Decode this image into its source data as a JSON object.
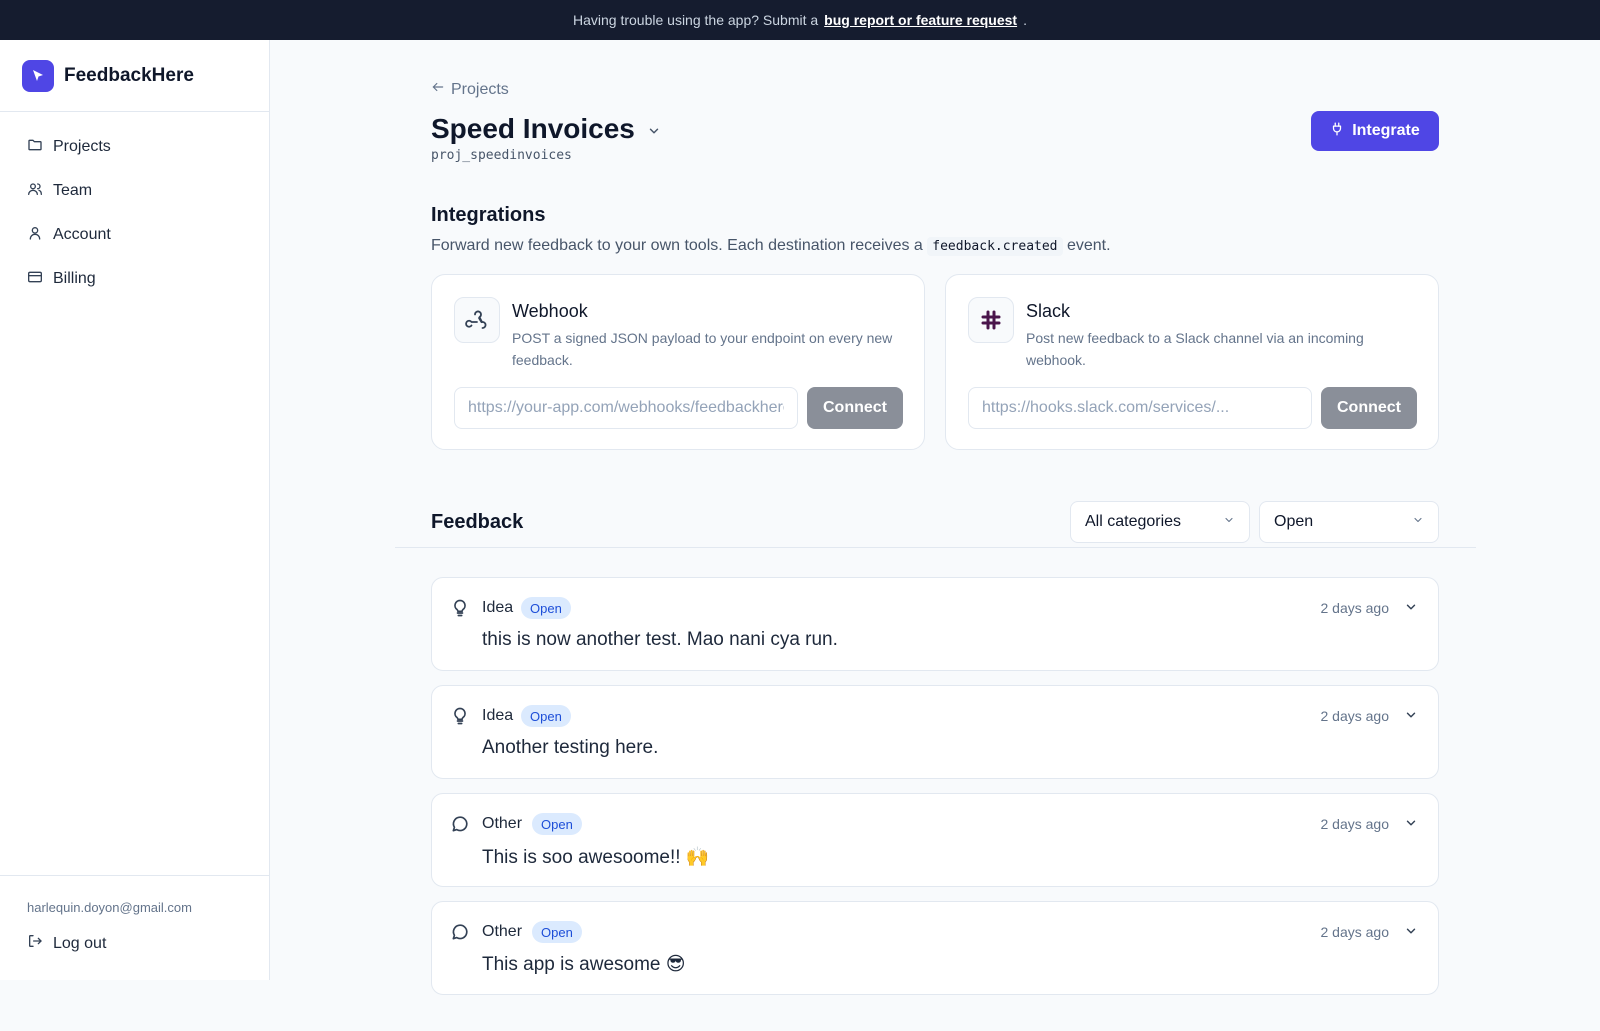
{
  "banner": {
    "text": "Having trouble using the app? Submit a",
    "link": "bug report or feature request",
    "suffix": "."
  },
  "brand": {
    "name": "FeedbackHere"
  },
  "sidebar": {
    "items": [
      {
        "label": "Projects",
        "icon": "folder-icon"
      },
      {
        "label": "Team",
        "icon": "users-icon"
      },
      {
        "label": "Account",
        "icon": "user-icon"
      },
      {
        "label": "Billing",
        "icon": "credit-card-icon"
      }
    ],
    "user_email": "harlequin.doyon@gmail.com",
    "logout_label": "Log out"
  },
  "header": {
    "back_label": "Projects",
    "project_name": "Speed Invoices",
    "project_id": "proj_speedinvoices",
    "integrate_label": "Integrate"
  },
  "integrations": {
    "title": "Integrations",
    "desc_before": "Forward new feedback to your own tools. Each destination receives a",
    "desc_code": "feedback.created",
    "desc_after": "event.",
    "cards": [
      {
        "name": "Webhook",
        "desc": "POST a signed JSON payload to your endpoint on every new feedback.",
        "placeholder": "https://your-app.com/webhooks/feedbackhere",
        "button": "Connect"
      },
      {
        "name": "Slack",
        "desc": "Post new feedback to a Slack channel via an incoming webhook.",
        "placeholder": "https://hooks.slack.com/services/...",
        "button": "Connect"
      }
    ]
  },
  "feedback": {
    "title": "Feedback",
    "category_filter": "All categories",
    "status_filter": "Open",
    "items": [
      {
        "category": "Idea",
        "status": "Open",
        "time": "2 days ago",
        "text": "this is now another test. Mao nani cya run."
      },
      {
        "category": "Idea",
        "status": "Open",
        "time": "2 days ago",
        "text": "Another testing here."
      },
      {
        "category": "Other",
        "status": "Open",
        "time": "2 days ago",
        "text": "This is soo awesoome!! 🙌"
      },
      {
        "category": "Other",
        "status": "Open",
        "time": "2 days ago",
        "text": "This app is awesome 😎"
      }
    ]
  },
  "colors": {
    "accent": "#4f46e5",
    "banner_bg": "#151c2f",
    "badge_bg": "#dbeafe",
    "badge_text": "#1d4ed8"
  }
}
